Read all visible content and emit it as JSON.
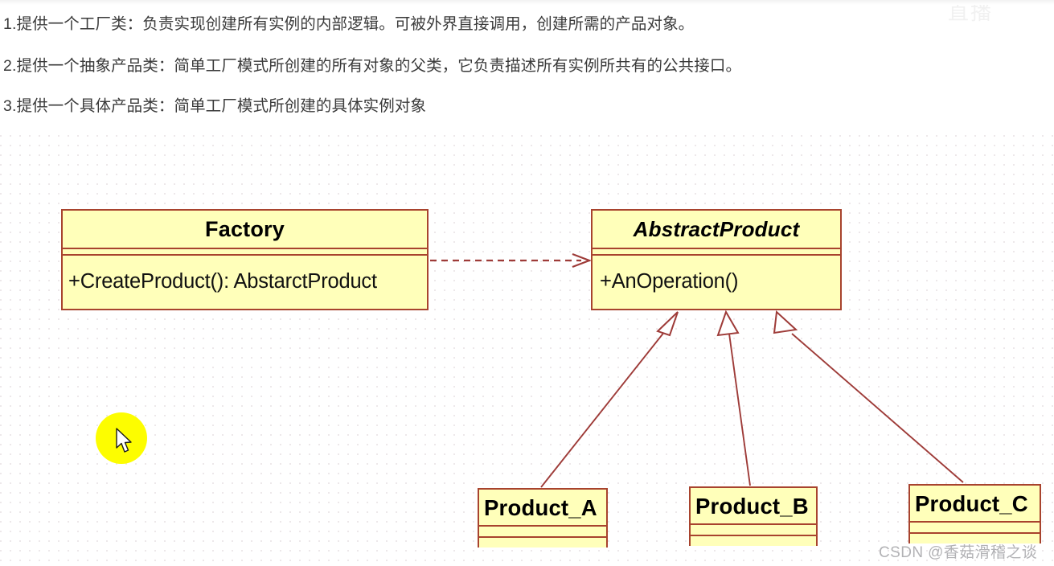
{
  "notes": {
    "line1": "1.提供一个工厂类：负责实现创建所有实例的内部逻辑。可被外界直接调用，创建所需的产品对象。",
    "line2": "2.提供一个抽象产品类：简单工厂模式所创建的所有对象的父类，它负责描述所有实例所共有的公共接口。",
    "line3": "3.提供一个具体产品类：简单工厂模式所创建的具体实例对象"
  },
  "diagram": {
    "type": "uml-class-diagram",
    "classes": [
      {
        "id": "factory",
        "name": "Factory",
        "stereotype": "concrete",
        "members": "+CreateProduct(): AbstarctProduct"
      },
      {
        "id": "abstract_product",
        "name": "AbstractProduct",
        "stereotype": "abstract",
        "members": "+AnOperation()"
      },
      {
        "id": "product_a",
        "name": "Product_A",
        "stereotype": "concrete",
        "members": ""
      },
      {
        "id": "product_b",
        "name": "Product_B",
        "stereotype": "concrete",
        "members": ""
      },
      {
        "id": "product_c",
        "name": "Product_C",
        "stereotype": "concrete",
        "members": ""
      }
    ],
    "relations": [
      {
        "from": "factory",
        "to": "abstract_product",
        "kind": "dependency",
        "style": "dashed-open-arrow"
      },
      {
        "from": "product_a",
        "to": "abstract_product",
        "kind": "generalization",
        "style": "solid-hollow-triangle"
      },
      {
        "from": "product_b",
        "to": "abstract_product",
        "kind": "generalization",
        "style": "solid-hollow-triangle"
      },
      {
        "from": "product_c",
        "to": "abstract_product",
        "kind": "generalization",
        "style": "solid-hollow-triangle"
      }
    ],
    "colors": {
      "box_fill": "#ffffba",
      "box_border": "#a8432e",
      "connector": "#9e3b38",
      "text": "#000000",
      "cursor_highlight": "#fdfd00"
    }
  },
  "watermark": {
    "bottom": "CSDN @香菇滑稽之谈",
    "top": "直播"
  }
}
